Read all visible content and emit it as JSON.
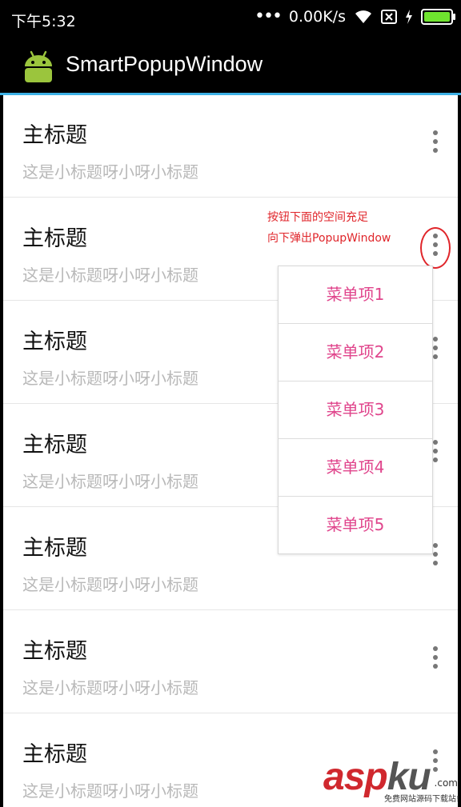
{
  "status_bar": {
    "time": "下午5:32",
    "network_speed": "0.00K/s",
    "icons": [
      "more-dots-icon",
      "wifi-icon",
      "sim-off-icon",
      "charging-icon",
      "battery-icon"
    ]
  },
  "app_bar": {
    "title": "SmartPopupWindow",
    "logo": "android-logo"
  },
  "list": {
    "items": [
      {
        "title": "主标题",
        "subtitle": "这是小标题呀小呀小标题"
      },
      {
        "title": "主标题",
        "subtitle": "这是小标题呀小呀小标题"
      },
      {
        "title": "主标题",
        "subtitle": "这是小标题呀小呀小标题"
      },
      {
        "title": "主标题",
        "subtitle": "这是小标题呀小呀小标题"
      },
      {
        "title": "主标题",
        "subtitle": "这是小标题呀小呀小标题"
      },
      {
        "title": "主标题",
        "subtitle": "这是小标题呀小呀小标题"
      },
      {
        "title": "主标题",
        "subtitle": "这是小标题呀小呀小标题"
      }
    ]
  },
  "popup_menu": {
    "items": [
      "菜单项1",
      "菜单项2",
      "菜单项3",
      "菜单项4",
      "菜单项5"
    ]
  },
  "annotation": {
    "line1": "按钮下面的空间充足",
    "line2": "向下弹出PopupWindow"
  },
  "watermark": {
    "brand_red": "asp",
    "brand_gray": "ku",
    "suffix": ".com",
    "tagline": "免费网站源码下载站!"
  },
  "colors": {
    "accent_line": "#3db1e6",
    "menu_text": "#e0458c",
    "annotation": "#e0262b",
    "battery": "#6fe32f"
  }
}
